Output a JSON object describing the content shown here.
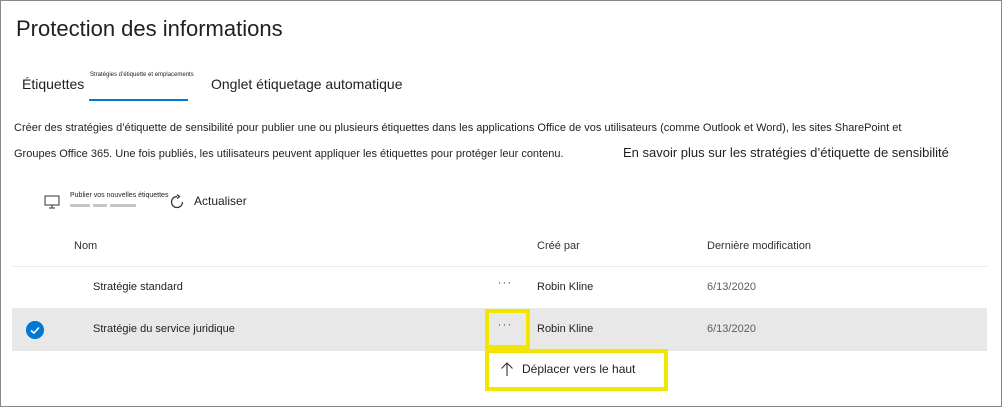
{
  "page": {
    "title": "Protection des informations",
    "description_line1": "Créer des stratégies d’étiquette de sensibilité pour publier une ou plusieurs étiquettes dans les applications Office de vos utilisateurs (comme Outlook et Word), les sites SharePoint et",
    "description_line2": "Groupes Office 365. Une fois publiés, les utilisateurs peuvent appliquer les étiquettes pour protéger leur contenu.",
    "learn_more": "En savoir plus sur les stratégies d’étiquette de sensibilité"
  },
  "tabs": [
    {
      "label": "Étiquettes",
      "selected": false
    },
    {
      "label": "Stratégies d’étiquette et emplacements",
      "selected": true
    },
    {
      "label": "Onglet étiquetage automatique",
      "selected": false
    }
  ],
  "toolbar": {
    "publish_label": "Publier vos nouvelles étiquettes",
    "publish_icon": "monitor-icon",
    "refresh_label": "Actualiser",
    "refresh_icon": "refresh-icon"
  },
  "table": {
    "columns": [
      "Nom",
      "Créé par",
      "Dernière modification"
    ],
    "rows": [
      {
        "name": "Stratégie standard",
        "created_by": "Robin Kline",
        "modified": "6/13/2020",
        "selected": false,
        "more": "···"
      },
      {
        "name": "Stratégie du service juridique",
        "created_by": "Robin Kline",
        "modified": "6/13/2020",
        "selected": true,
        "more": "···"
      }
    ]
  },
  "context_menu": {
    "items": [
      {
        "label": "Déplacer vers le haut",
        "icon": "arrow-up-icon"
      }
    ]
  },
  "colors": {
    "accent": "#0078d4",
    "highlight": "#f2e600",
    "selected_row": "#e8e8e8"
  }
}
